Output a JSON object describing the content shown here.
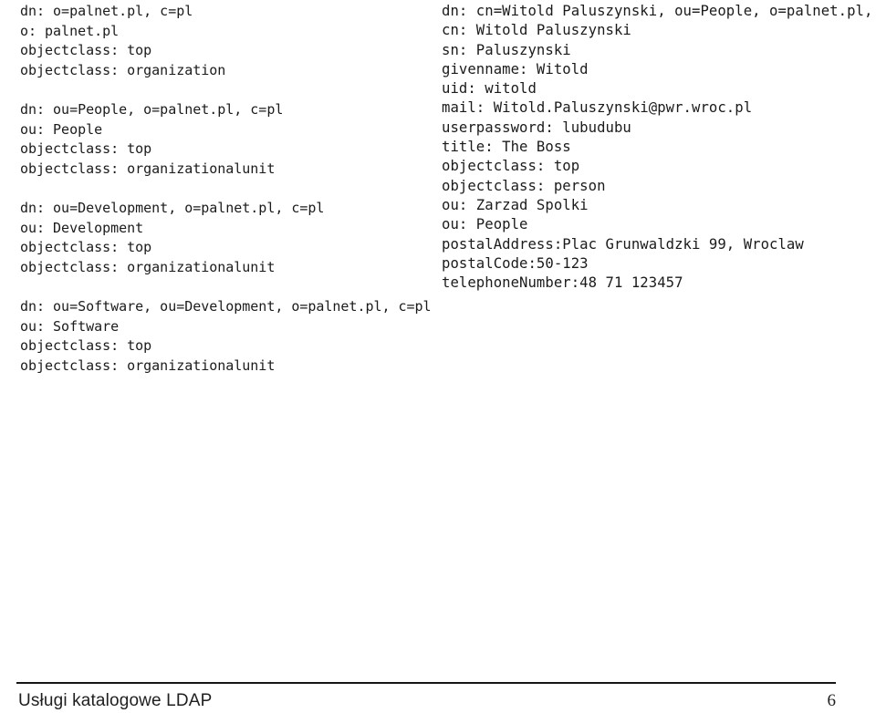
{
  "slide": {
    "background_color": "#ffffff",
    "text_color": "#1b1b1b"
  },
  "left_column": {
    "name": "ldif-directory-tree-entries",
    "blocks": [
      {
        "name": "entry-organization-palnet",
        "lines": [
          "dn: o=palnet.pl, c=pl",
          "o: palnet.pl",
          "objectclass: top",
          "objectclass: organization"
        ]
      },
      {
        "name": "entry-ou-people",
        "lines": [
          "dn: ou=People, o=palnet.pl, c=pl",
          "ou: People",
          "objectclass: top",
          "objectclass: organizationalunit"
        ]
      },
      {
        "name": "entry-ou-development",
        "lines": [
          "dn: ou=Development, o=palnet.pl, c=pl",
          "ou: Development",
          "objectclass: top",
          "objectclass: organizationalunit"
        ]
      },
      {
        "name": "entry-ou-software",
        "lines": [
          "dn: ou=Software, ou=Development, o=palnet.pl, c=pl",
          "ou: Software",
          "objectclass: top",
          "objectclass: organizationalunit"
        ]
      }
    ]
  },
  "right_column": {
    "name": "ldif-person-entry",
    "blocks": [
      {
        "name": "entry-person-witold-paluszynski",
        "lines": [
          "dn: cn=Witold Paluszynski, ou=People, o=palnet.pl, c=pl",
          "cn: Witold Paluszynski",
          "sn: Paluszynski",
          "givenname: Witold",
          "uid: witold",
          "mail: Witold.Paluszynski@pwr.wroc.pl",
          "userpassword: lubudubu",
          "title: The Boss",
          "objectclass: top",
          "objectclass: person",
          "ou: Zarzad Spolki",
          "ou: People",
          "postalAddress:Plac Grunwaldzki 99, Wroclaw",
          "postalCode:50-123",
          "telephoneNumber:48 71 123457"
        ]
      }
    ]
  },
  "footer": {
    "title": "Usługi katalogowe LDAP",
    "page_number": "6"
  }
}
